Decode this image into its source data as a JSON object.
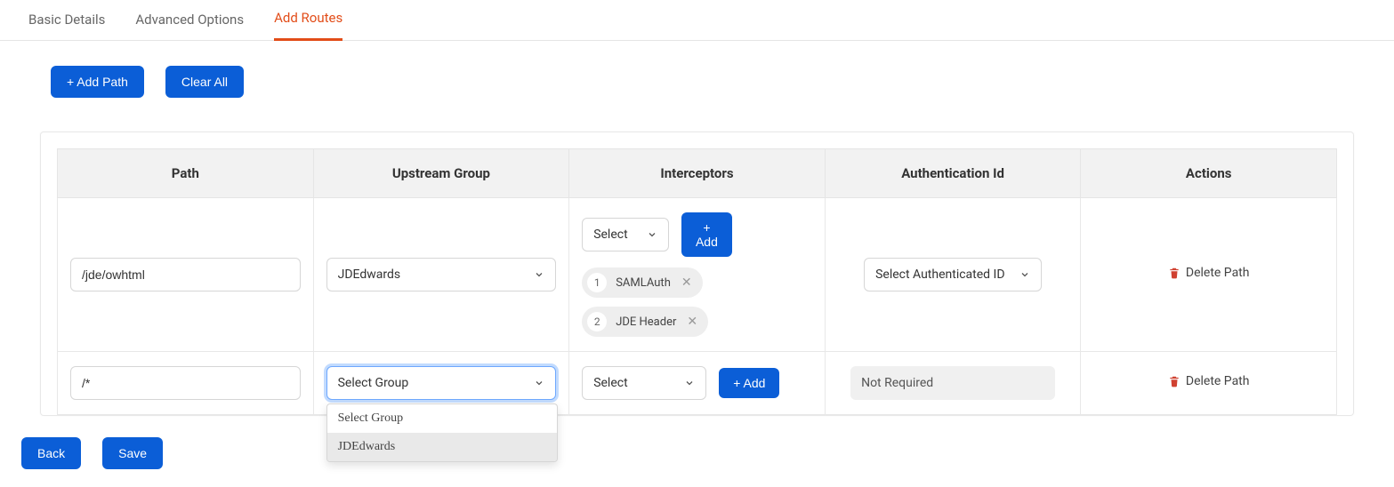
{
  "tabs": {
    "basic": "Basic Details",
    "advanced": "Advanced Options",
    "routes": "Add Routes"
  },
  "toolbar": {
    "add_path": "+ Add Path",
    "clear_all": "Clear All"
  },
  "table": {
    "headers": {
      "path": "Path",
      "upstream": "Upstream Group",
      "interceptors": "Interceptors",
      "auth": "Authentication Id",
      "actions": "Actions"
    },
    "interceptor_select_placeholder": "Select",
    "interceptor_add": "+ Add",
    "group_select_placeholder": "Select Group",
    "auth_select_placeholder": "Select Authenticated ID",
    "delete_label": "Delete Path",
    "rows": [
      {
        "path": "/jde/owhtml",
        "group": "JDEdwards",
        "interceptors": [
          {
            "n": "1",
            "label": "SAMLAuth"
          },
          {
            "n": "2",
            "label": "JDE Header"
          }
        ],
        "auth": ""
      },
      {
        "path": "/*",
        "group": "",
        "interceptors": [],
        "auth": "Not Required"
      }
    ],
    "dropdown_options": [
      "Select Group",
      "JDEdwards"
    ]
  },
  "footer": {
    "back": "Back",
    "save": "Save"
  },
  "colors": {
    "accent_blue": "#0b5ed7",
    "accent_orange": "#e24c18",
    "danger": "#d04131"
  }
}
